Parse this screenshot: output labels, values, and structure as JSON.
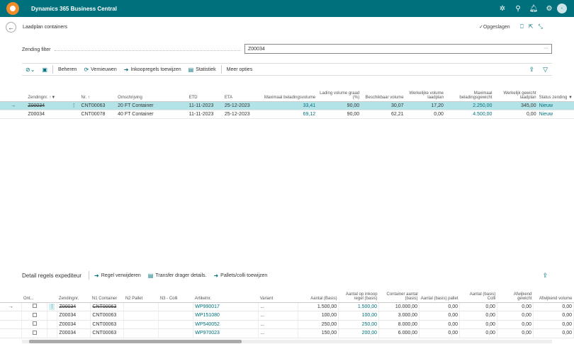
{
  "app": {
    "title": "Dynamics 365 Business Central"
  },
  "page": {
    "title": "Laadplan containers",
    "status": "Opgeslagen"
  },
  "filter": {
    "label": "Zending filter",
    "value": "Z00034"
  },
  "toolbar": {
    "beheren": "Beheren",
    "vernieuwen": "Vernieuwen",
    "inkoopregels": "Inkoopregels toewijzen",
    "statistiek": "Statistiek",
    "meer_opties": "Meer opties"
  },
  "grid1": {
    "headers": [
      "Zendingnr.",
      "Nr.",
      "Omschrijving",
      "ETD",
      "ETA",
      "Maximaal beladingsvolume",
      "Lading volume graad (%)",
      "Beschikbaar volume",
      "Werkelijke volume laadplan",
      "Maximaal beladingsgewicht",
      "Werkelijk gewicht laadplan",
      "Status zending"
    ],
    "rows": [
      [
        "Z00034",
        "CNT00063",
        "20 FT Container",
        "11-11-2023",
        "25-12-2023",
        "33,41",
        "90,00",
        "30,07",
        "17,20",
        "2.250,00",
        "345,00",
        "Nieuw"
      ],
      [
        "Z00034",
        "CNT00078",
        "40 FT Container",
        "11-11-2023",
        "25-12-2023",
        "69,12",
        "90,00",
        "62,21",
        "0,00",
        "4.500,00",
        "0,00",
        "Nieuw"
      ]
    ]
  },
  "detail": {
    "title": "Detail regels expediteur",
    "actions": [
      "Regel verwijderen",
      "Transfer drager details.",
      "Pallets/colli toewijzen"
    ]
  },
  "grid2": {
    "headers": [
      "Ont...",
      "Zendingnr.",
      "N1 Container",
      "N2 Pallet",
      "N3 - Colli",
      "Artikelnr.",
      "Variant",
      "Aantal (Basis)",
      "Aantal op inkoop regel (basis)",
      "Container aantal (basis)",
      "Aantal (basis) pallet",
      "Aantal (basis) Colli",
      "Afwijkend gewicht",
      "Afwijkend volume"
    ],
    "rows": [
      [
        "Z00034",
        "CNT00063",
        "",
        "",
        "WP990017",
        "...",
        "1.500,00",
        "1.500,00",
        "10.000,00",
        "0,00",
        "0,00",
        "0,00",
        "0,00"
      ],
      [
        "Z00034",
        "CNT00063",
        "",
        "",
        "WP151080",
        "...",
        "100,00",
        "100,00",
        "3.000,00",
        "0,00",
        "0,00",
        "0,00",
        "0,00"
      ],
      [
        "Z00034",
        "CNT00063",
        "",
        "",
        "WP540052",
        "...",
        "250,00",
        "250,00",
        "8.000,00",
        "0,00",
        "0,00",
        "0,00",
        "0,00"
      ],
      [
        "Z00034",
        "CNT00063",
        "",
        "",
        "WP970023",
        "...",
        "150,00",
        "200,00",
        "6.000,00",
        "0,00",
        "0,00",
        "0,00",
        "0,00"
      ]
    ]
  },
  "colors": {
    "brand": "#00707c",
    "selected_row": "#b4e3e7",
    "link": "#00707c",
    "logo": "#f28c28"
  }
}
